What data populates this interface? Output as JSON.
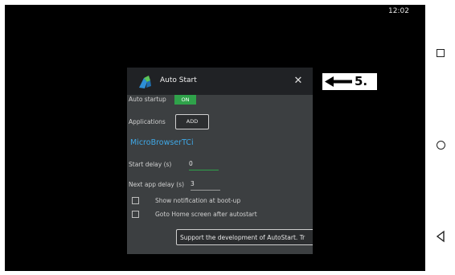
{
  "status_bar": {
    "time": "12:02"
  },
  "dialog": {
    "title": "Auto Start",
    "close_glyph": "✕",
    "auto_startup": {
      "label": "Auto startup",
      "toggle_text": "ON"
    },
    "applications": {
      "label": "Applications",
      "add_label": "ADD"
    },
    "app_list": [
      "MicroBrowserTCi"
    ],
    "start_delay": {
      "label": "Start delay (s)",
      "value": "0"
    },
    "next_app_delay": {
      "label": "Next app delay (s)",
      "value": "3"
    },
    "options": [
      {
        "label": "Show notification at boot-up",
        "checked": false
      },
      {
        "label": "Goto Home screen after autostart",
        "checked": false
      }
    ],
    "support_button": "Support the development of AutoStart. Tr"
  },
  "callout": {
    "text": "5.",
    "color": "#000000"
  },
  "colors": {
    "accent": "#2fa24a",
    "link": "#3fa8e6",
    "dialog_bg": "#3c3f41",
    "header_bg": "#202225"
  },
  "icons": {
    "app": "autostart-app-icon",
    "close": "close-icon",
    "nav": [
      "square-recents-icon",
      "circle-home-icon",
      "triangle-back-icon"
    ]
  }
}
